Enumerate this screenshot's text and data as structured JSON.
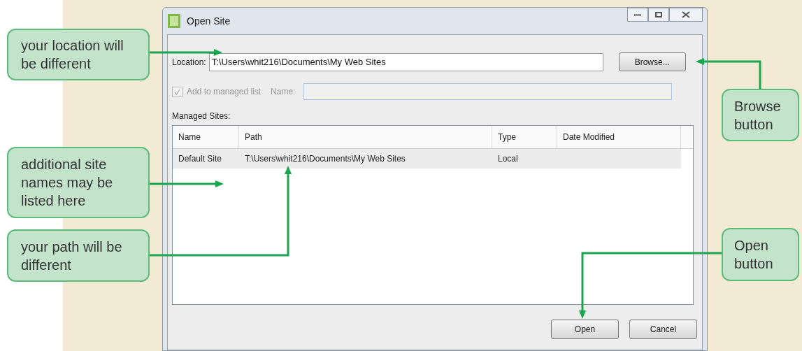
{
  "window": {
    "title": "Open Site"
  },
  "location": {
    "label": "Location:",
    "value": "T:\\Users\\whit216\\Documents\\My Web Sites"
  },
  "browse_button": "Browse...",
  "managed": {
    "label": "Add to managed list",
    "checked": true,
    "disabled": true,
    "name_label": "Name:"
  },
  "managed_sites": {
    "label": "Managed Sites:",
    "columns": [
      "Name",
      "Path",
      "Type",
      "Date Modified"
    ],
    "rows": [
      {
        "cells": [
          "Default Site",
          "T:\\Users\\whit216\\Documents\\My Web Sites",
          "Local"
        ],
        "selected": true
      }
    ]
  },
  "buttons": [
    "Open",
    "Cancel"
  ],
  "callouts": [
    {
      "text": "your location will be different"
    },
    {
      "text": "additional site names may be listed here"
    },
    {
      "text": "your path will be different"
    },
    {
      "text": "Browse button"
    },
    {
      "text": "Open button"
    }
  ]
}
